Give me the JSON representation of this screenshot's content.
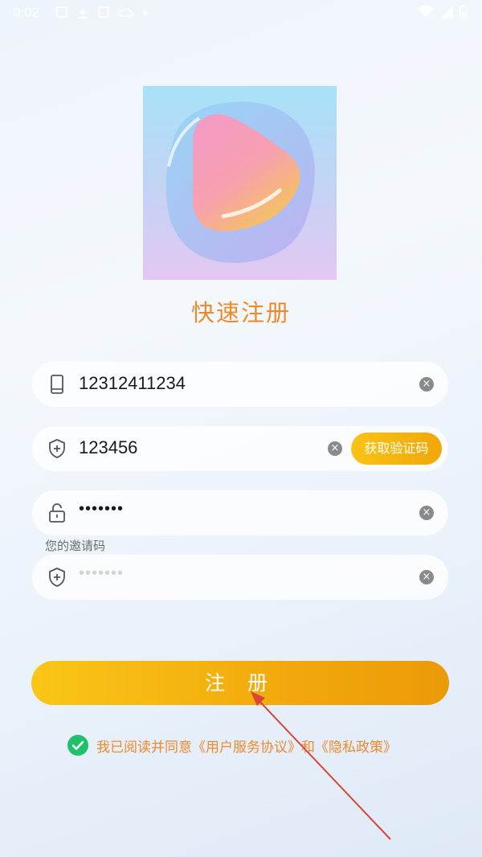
{
  "status_bar": {
    "time": "9:02",
    "icons": [
      "photo-icon",
      "download-icon",
      "app-icon",
      "cloud-icon",
      "dot-icon"
    ],
    "right_icons": [
      "wifi-icon",
      "signal-icon",
      "battery-icon"
    ]
  },
  "app": {
    "title": "快速注册"
  },
  "form": {
    "phone": {
      "value": "12312411234",
      "icon": "phone-icon"
    },
    "code": {
      "value": "123456",
      "icon": "shield-icon",
      "button_label": "获取验证码"
    },
    "password": {
      "value": "•••••••",
      "icon": "lock-icon"
    },
    "invite": {
      "label": "您的邀请码",
      "placeholder": "•••••••",
      "icon": "shield-plus-icon"
    }
  },
  "actions": {
    "register_label": "注 册"
  },
  "agreement": {
    "checked": true,
    "text": "我已阅读并同意《用户服务协议》和《隐私政策》"
  },
  "colors": {
    "accent": "#ef8a2c",
    "button_start": "#f9c616",
    "button_end": "#eb9a08",
    "check": "#1fc26a"
  }
}
